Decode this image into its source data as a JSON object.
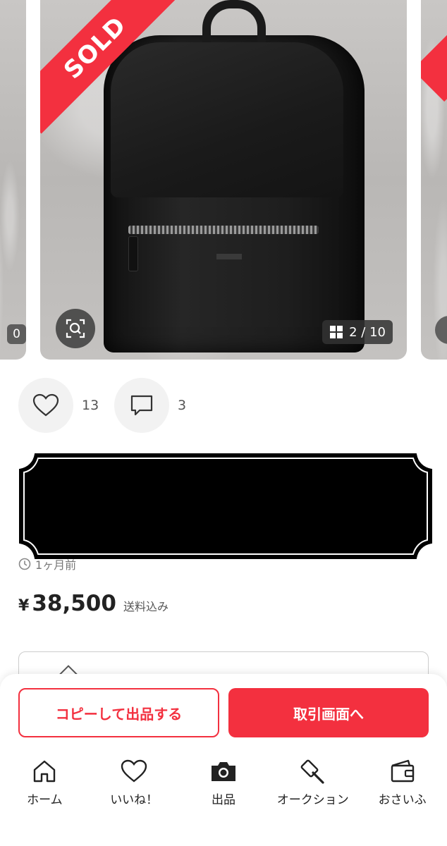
{
  "gallery": {
    "sold_label": "SOLD",
    "counter": "2 / 10",
    "left_counter": "0"
  },
  "actions": {
    "likes_count": "13",
    "comments_count": "3"
  },
  "item": {
    "timestamp": "1ヶ月前",
    "price_value": "38,500",
    "currency": "¥",
    "shipping_note": "送料込み"
  },
  "buttons": {
    "copy_label": "コピーして出品する",
    "trade_label": "取引画面へ"
  },
  "nav": {
    "items": [
      {
        "label": "ホーム",
        "icon": "home-icon"
      },
      {
        "label": "いいね！",
        "icon": "heart-icon"
      },
      {
        "label": "出品",
        "icon": "camera-icon"
      },
      {
        "label": "オークション",
        "icon": "gavel-icon"
      },
      {
        "label": "おさいふ",
        "icon": "wallet-icon"
      }
    ]
  },
  "colors": {
    "accent": "#f3303f"
  }
}
